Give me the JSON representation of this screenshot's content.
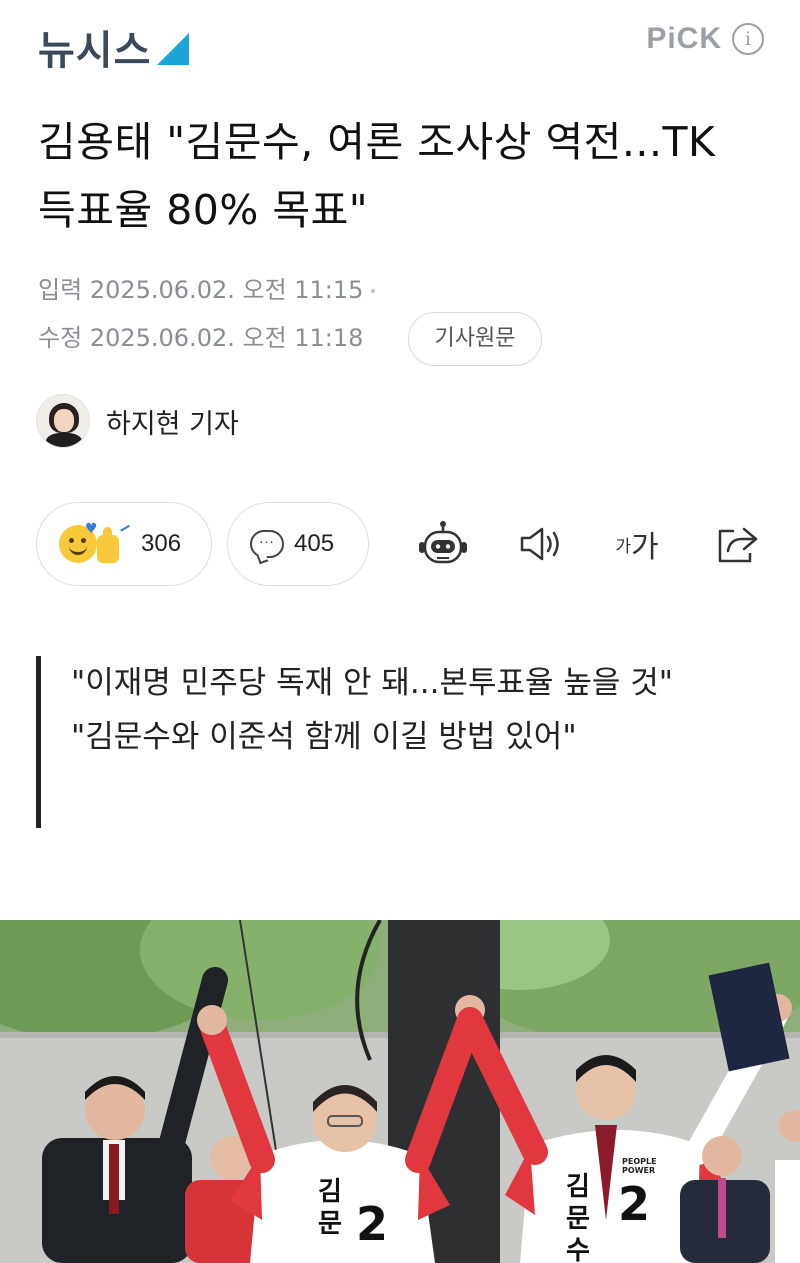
{
  "header": {
    "logo_text": "뉴시스",
    "pick_label": "PiCK",
    "info_icon": "i"
  },
  "article": {
    "title": "김용태 \"김문수, 여론 조사상 역전...TK 득표율 80% 목표\"",
    "input_label": "입력",
    "input_time": "2025.06.02. 오전 11:15",
    "modified_label": "수정",
    "modified_time": "2025.06.02. 오전 11:18",
    "original_button": "기사원문",
    "reporter": "하지현 기자",
    "subtitles": [
      "\"이재명 민주당 독재 안 돼...본투표율 높을 것\"",
      "\"김문수와 이준석 함께 이길 방법 있어\""
    ]
  },
  "toolbar": {
    "reaction_count": "306",
    "comment_count": "405",
    "fontsize_small": "가",
    "fontsize_big": "가",
    "icons": [
      "reaction-emoji-icon",
      "comment-icon",
      "robot-summary-icon",
      "speaker-icon",
      "font-size-icon",
      "share-icon"
    ]
  },
  "photo": {
    "jersey_name_center": "김문수",
    "jersey_name_right": "김문수",
    "jersey_number": "2",
    "jersey_badge": "PEOPLE POWER"
  },
  "colors": {
    "logo_accent": "#1ca4d8",
    "logo_text": "#3b4a5a",
    "meta_text": "#8a8f96",
    "jersey_red": "#e0383e"
  }
}
